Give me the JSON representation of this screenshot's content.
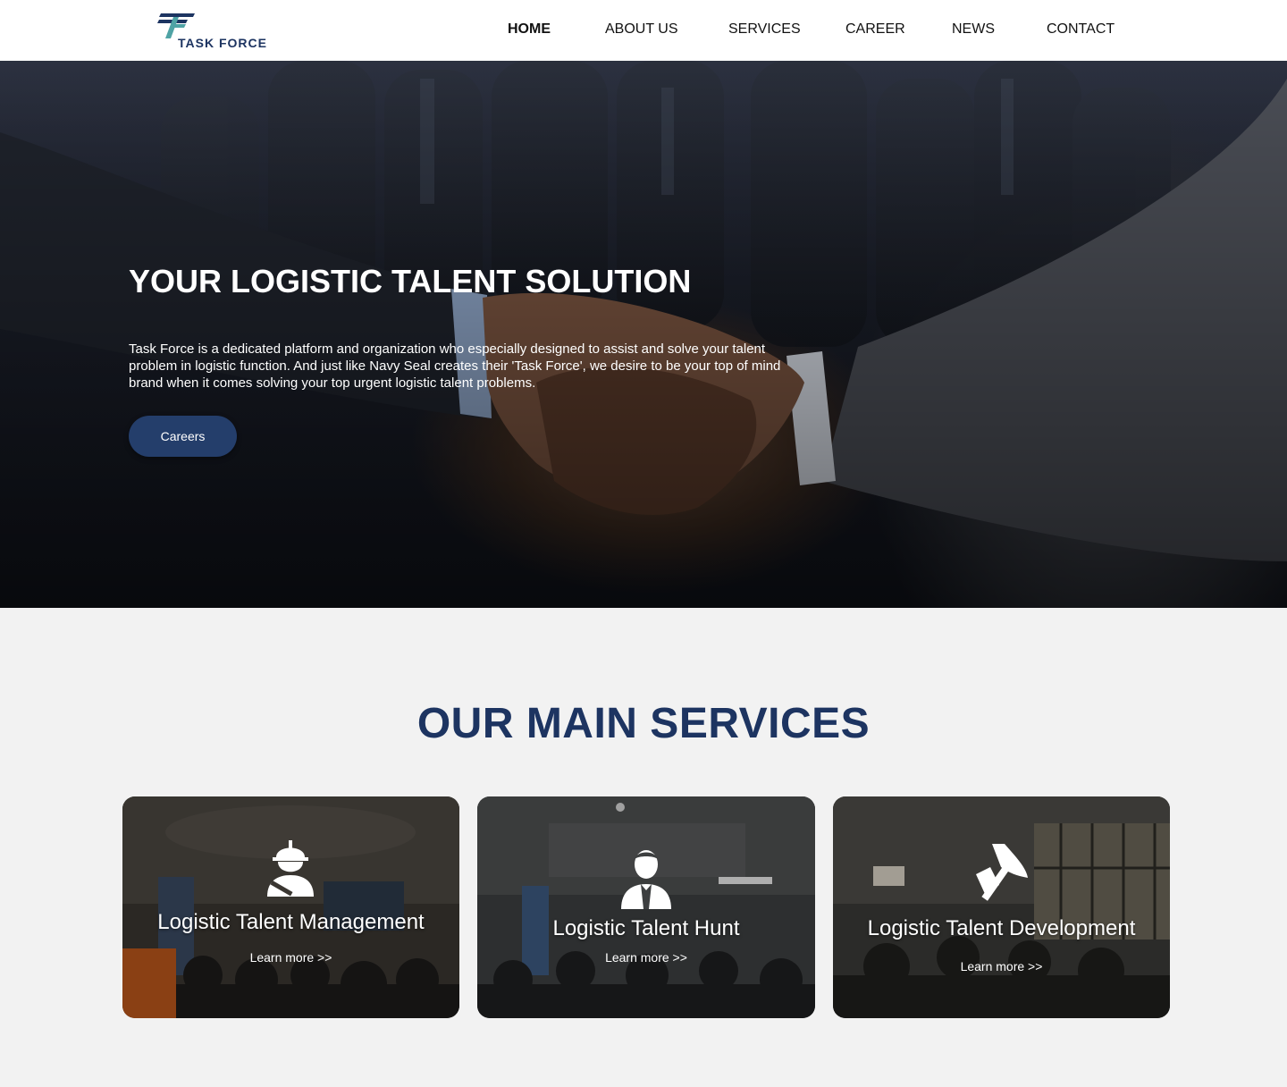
{
  "header": {
    "logo_text": "TASK FORCE",
    "nav": [
      {
        "label": "HOME",
        "active": true
      },
      {
        "label": "ABOUT US",
        "active": false
      },
      {
        "label": "SERVICES",
        "active": false
      },
      {
        "label": "CAREER",
        "active": false
      },
      {
        "label": "NEWS",
        "active": false
      },
      {
        "label": "CONTACT",
        "active": false
      }
    ]
  },
  "hero": {
    "title": "YOUR LOGISTIC TALENT SOLUTION",
    "description": "Task Force is a dedicated platform and organization who especially designed to assist and solve your talent problem in logistic function. And just like Navy Seal creates their 'Task Force', we desire to be your top  of mind brand when it comes solving your top urgent logistic talent problems.",
    "button_label": "Careers"
  },
  "services": {
    "title": "OUR MAIN SERVICES",
    "cards": [
      {
        "title": "Logistic Talent Management",
        "link": "Learn more >>",
        "icon": "construction-worker-icon"
      },
      {
        "title": "Logistic Talent Hunt",
        "link": "Learn more >>",
        "icon": "businessman-icon"
      },
      {
        "title": "Logistic Talent Development",
        "link": "Learn more >>",
        "icon": "axe-tool-icon"
      }
    ]
  },
  "colors": {
    "brand_navy": "#1d3461",
    "button": "#243e6b",
    "logo_teal": "#4fa3a5"
  }
}
